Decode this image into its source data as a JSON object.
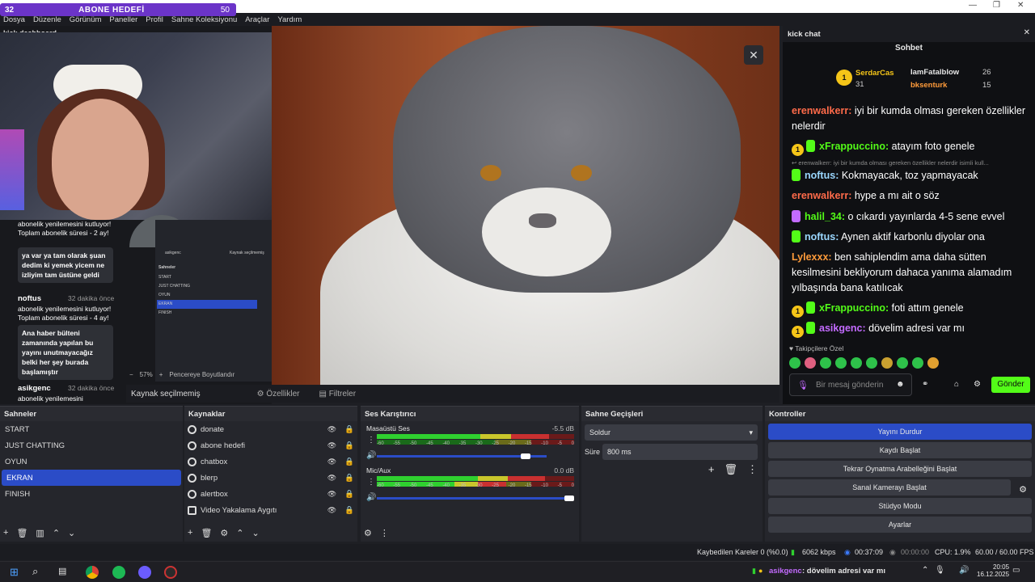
{
  "goal": {
    "left": "32",
    "title": "ABONE HEDEFİ",
    "right": "50"
  },
  "menu": [
    "Dosya",
    "Düzenle",
    "Görünüm",
    "Paneller",
    "Profil",
    "Sahne Koleksiyonu",
    "Araçlar",
    "Yardım"
  ],
  "left_pane": {
    "title": "kick dashboard",
    "msg1": "abonelik yenilemesini kutluyor! Toplam abonelik süresi - 2 ay!",
    "bubble1": "ya var ya tam olarak şuan dedim ki yemek yicem ne izliyim tam üstüne geldi",
    "user2": "noftus",
    "time2": "32 dakika önce",
    "msg2": "abonelik yenilemesini kutluyor! Toplam abonelik süresi - 4 ay!",
    "bubble2": "Ana haber bülteni zamanında yapılan bu yayını unutmayacağız belki her şey burada başlamıştır",
    "user3": "asikgenc",
    "time3": "32 dakika önce",
    "msg3": "abonelik yenilemesini",
    "zoom": "57%",
    "fit": "Pencereye Boyutlandır",
    "inner_scenes": [
      "START",
      "JUST CHATTING",
      "OYUN",
      "EKRAN",
      "FINISH"
    ],
    "inner_title": "Sahneler",
    "inner_source": "Kaynak seçilmemiş",
    "inner_user": "asikgenc"
  },
  "preview_bar": {
    "no_source": "Kaynak seçilmemiş",
    "props": "Özellikler",
    "filters": "Filtreler"
  },
  "chat": {
    "title": "kick chat",
    "tab": "Sohbet",
    "podium": [
      {
        "rank": "1",
        "name": "SerdarCas",
        "count": "31"
      },
      {
        "name": "IamFatalblow",
        "count": "26"
      },
      {
        "name": "bksenturk",
        "count": "15"
      }
    ],
    "messages": [
      {
        "user": "erenwalkerr",
        "text": " iyi bir kumda olması gereken özellikler nelerdir",
        "color": "#ff6b4a"
      },
      {
        "user": "xFrappuccino",
        "text": " atayım foto genele",
        "color": "#53fc18"
      },
      {
        "reply": "erenwalkerr: iyi bir kumda olması gereken özellikler nelerdir isimli kull..."
      },
      {
        "user": "noftus",
        "text": " Kokmayacak, toz yapmayacak",
        "color": "#9ad7ff"
      },
      {
        "user": "erenwalkerr",
        "text": " hype a mı ait o söz",
        "color": "#ff6b4a"
      },
      {
        "user": "halil_34",
        "text": " o cıkardı yayınlarda 4-5 sene evvel",
        "color": "#53fc18"
      },
      {
        "user": "noftus",
        "text": " Aynen aktif karbonlu diyolar ona",
        "color": "#9ad7ff"
      },
      {
        "user": "Lylexxx",
        "text": " ben sahiplendim ama daha sütten kesilmesini bekliyorum dahaca yanıma alamadım yılbaşında bana katılıcak",
        "color": "#ff9b3a"
      },
      {
        "user": "xFrappuccino",
        "text": " foti attım genele",
        "color": "#53fc18"
      },
      {
        "user": "asikgenc",
        "text": " dövelim adresi var mı",
        "color": "#c36bff"
      }
    ],
    "followers_only": "Takipçilere Özel",
    "input_placeholder": "Bir mesaj gönderin",
    "send": "Gönder"
  },
  "docks": {
    "scenes_title": "Sahneler",
    "scenes": [
      "START",
      "JUST CHATTING",
      "OYUN",
      "EKRAN",
      "FINISH"
    ],
    "sources_title": "Kaynaklar",
    "sources": [
      "donate",
      "abone hedefi",
      "chatbox",
      "blerp",
      "alertbox",
      "Video Yakalama Aygıtı"
    ],
    "mixer_title": "Ses Karıştırıcı",
    "mixer": [
      {
        "name": "Masaüstü Ses",
        "db": "-5.5 dB"
      },
      {
        "name": "Mic/Aux",
        "db": "0.0 dB"
      }
    ],
    "scale": [
      "-60",
      "-55",
      "-50",
      "-45",
      "-40",
      "-35",
      "-30",
      "-25",
      "-20",
      "-15",
      "-10",
      "-5",
      "0"
    ],
    "trans_title": "Sahne Geçişleri",
    "transition": "Soldur",
    "duration_label": "Süre",
    "duration": "800 ms",
    "controls_title": "Kontroller",
    "controls": [
      "Yayını Durdur",
      "Kaydı Başlat",
      "Tekrar Oynatma Arabelleğini Başlat",
      "Sanal Kamerayı Başlat",
      "Stüdyo Modu",
      "Ayarlar"
    ]
  },
  "status": {
    "dropped": "Kaybedilen Kareler 0 (%0.0)",
    "kbps": "6062 kbps",
    "live": "00:37:09",
    "rec": "00:00:00",
    "cpu": "CPU: 1.9%",
    "fps": "60.00 / 60.00 FPS"
  },
  "taskbar": {
    "ticker_user": "asikgenc",
    "ticker_text": ": dövelim adresi var mı",
    "time": "20:05",
    "date": "16.12.2025"
  }
}
